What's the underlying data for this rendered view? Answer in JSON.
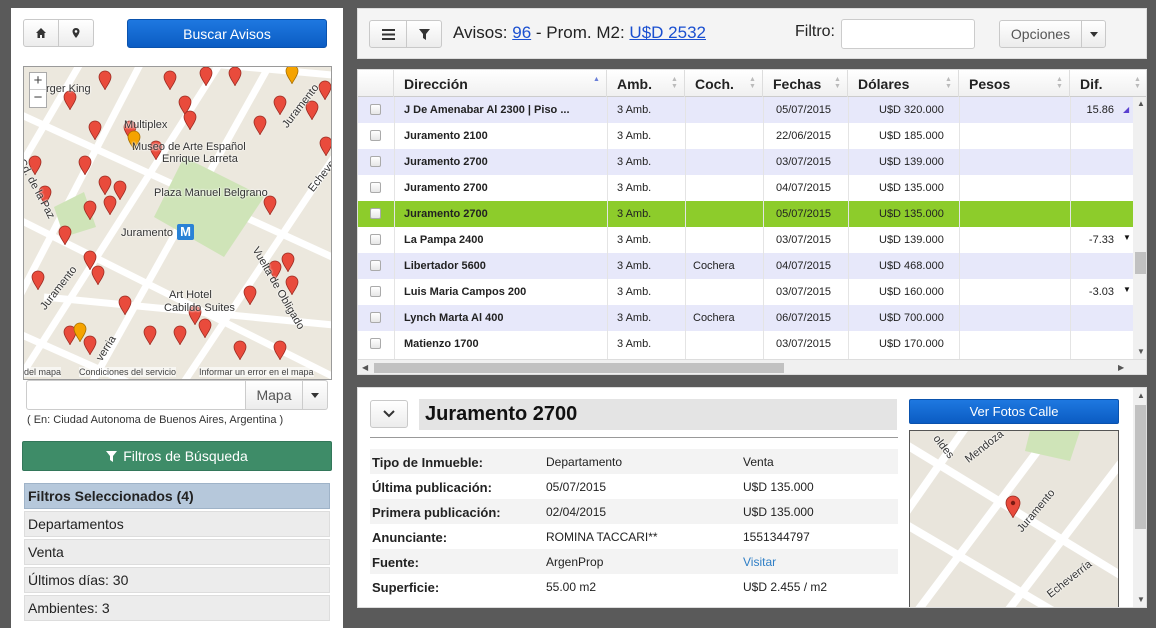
{
  "left": {
    "buscar_label": "Buscar Avisos",
    "map": {
      "labels": {
        "burger": "rger King",
        "multiplex": "Multiplex",
        "museo": "Museo de Arte Español",
        "larreta": "Enrique Larreta",
        "plaza": "Plaza Manuel Belgrano",
        "juramento": "Juramento",
        "cdelapaz": "Cd. de la Paz",
        "jurament_right": "Juramento",
        "echeve": "Echeve",
        "mendoza": "Mendoza",
        "juramento_sw": "Juramento",
        "vuelta": "Vuelta de Obligado",
        "hotel": "Art Hotel",
        "cabildo": "Cabildo Suites",
        "verria": "verria"
      },
      "metro_letter": "M",
      "zoom_in": "+",
      "zoom_out": "−",
      "footer_left": "del mapa",
      "footer_mid": "Condiciones del servicio",
      "footer_right": "Informar un error en el mapa"
    },
    "search_placeholder": "",
    "mapa_label": "Mapa",
    "location_hint": "( En: Ciudad Autonoma de Buenos Aires, Argentina )",
    "filtros_label": "Filtros de Búsqueda",
    "selected_header": "Filtros Seleccionados (4)",
    "selected_items": [
      "Departamentos",
      "Venta",
      "Últimos días: 30",
      "Ambientes: 3"
    ]
  },
  "topbar": {
    "avisos_label": "Avisos:",
    "avisos_count": "96",
    "prom_label": "- Prom. M2:",
    "prom_value": "U$D 2532",
    "filtro_label": "Filtro:",
    "filtro_value": "",
    "opciones_label": "Opciones"
  },
  "grid": {
    "columns": [
      "Dirección",
      "Amb.",
      "Coch.",
      "Fechas",
      "Dólares",
      "Pesos",
      "Dif."
    ],
    "rows": [
      {
        "dir": "J De Amenabar Al 2300 | Piso ...",
        "amb": "3 Amb.",
        "coch": "",
        "fecha": "05/07/2015",
        "dolares": "U$D 320.000",
        "pesos": "",
        "dif": "15.86",
        "trend": "up"
      },
      {
        "dir": "Juramento 2100",
        "amb": "3 Amb.",
        "coch": "",
        "fecha": "22/06/2015",
        "dolares": "U$D 185.000",
        "pesos": "",
        "dif": "",
        "trend": ""
      },
      {
        "dir": "Juramento 2700",
        "amb": "3 Amb.",
        "coch": "",
        "fecha": "03/07/2015",
        "dolares": "U$D 139.000",
        "pesos": "",
        "dif": "",
        "trend": ""
      },
      {
        "dir": "Juramento 2700",
        "amb": "3 Amb.",
        "coch": "",
        "fecha": "04/07/2015",
        "dolares": "U$D 135.000",
        "pesos": "",
        "dif": "",
        "trend": ""
      },
      {
        "dir": "Juramento 2700",
        "amb": "3 Amb.",
        "coch": "",
        "fecha": "05/07/2015",
        "dolares": "U$D 135.000",
        "pesos": "",
        "dif": "",
        "trend": ""
      },
      {
        "dir": "La Pampa 2400",
        "amb": "3 Amb.",
        "coch": "",
        "fecha": "03/07/2015",
        "dolares": "U$D 139.000",
        "pesos": "",
        "dif": "-7.33",
        "trend": "down"
      },
      {
        "dir": "Libertador 5600",
        "amb": "3 Amb.",
        "coch": "Cochera",
        "fecha": "04/07/2015",
        "dolares": "U$D 468.000",
        "pesos": "",
        "dif": "",
        "trend": ""
      },
      {
        "dir": "Luis Maria Campos 200",
        "amb": "3 Amb.",
        "coch": "",
        "fecha": "03/07/2015",
        "dolares": "U$D 160.000",
        "pesos": "",
        "dif": "-3.03",
        "trend": "down"
      },
      {
        "dir": "Lynch Marta Al 400",
        "amb": "3 Amb.",
        "coch": "Cochera",
        "fecha": "06/07/2015",
        "dolares": "U$D 700.000",
        "pesos": "",
        "dif": "",
        "trend": ""
      },
      {
        "dir": "Matienzo 1700",
        "amb": "3 Amb.",
        "coch": "",
        "fecha": "03/07/2015",
        "dolares": "U$D 170.000",
        "pesos": "",
        "dif": "",
        "trend": ""
      }
    ],
    "selected_index": 4
  },
  "detail": {
    "title": "Juramento 2700",
    "ver_fotos_label": "Ver Fotos Calle",
    "rows": [
      {
        "k": "Tipo de Inmueble:",
        "v1": "Departamento",
        "v2": "Venta"
      },
      {
        "k": "Última publicación:",
        "v1": "05/07/2015",
        "v2": "U$D 135.000"
      },
      {
        "k": "Primera publicación:",
        "v1": "02/04/2015",
        "v2": "U$D 135.000"
      },
      {
        "k": "Anunciante:",
        "v1": "ROMINA TACCARI**",
        "v2": "1551344797"
      },
      {
        "k": "Fuente:",
        "v1": "ArgenProp",
        "v2": "Visitar"
      },
      {
        "k": "Superficie:",
        "v1": "55.00 m2",
        "v2": "U$D 2.455 / m2"
      }
    ],
    "small_map": {
      "mendoza": "Mendoza",
      "juramento": "Juramento",
      "echeverria": "Echeverría",
      "holdes": "oldes"
    }
  },
  "colors": {
    "primary_blue": "#0b5cc3",
    "filter_green": "#3e8c68",
    "selected_row": "#8dcc2b",
    "alt_row": "#e7e8fa",
    "link": "#1a4fd0",
    "pin_red": "#e94b3c",
    "pin_orange": "#f5a300"
  }
}
